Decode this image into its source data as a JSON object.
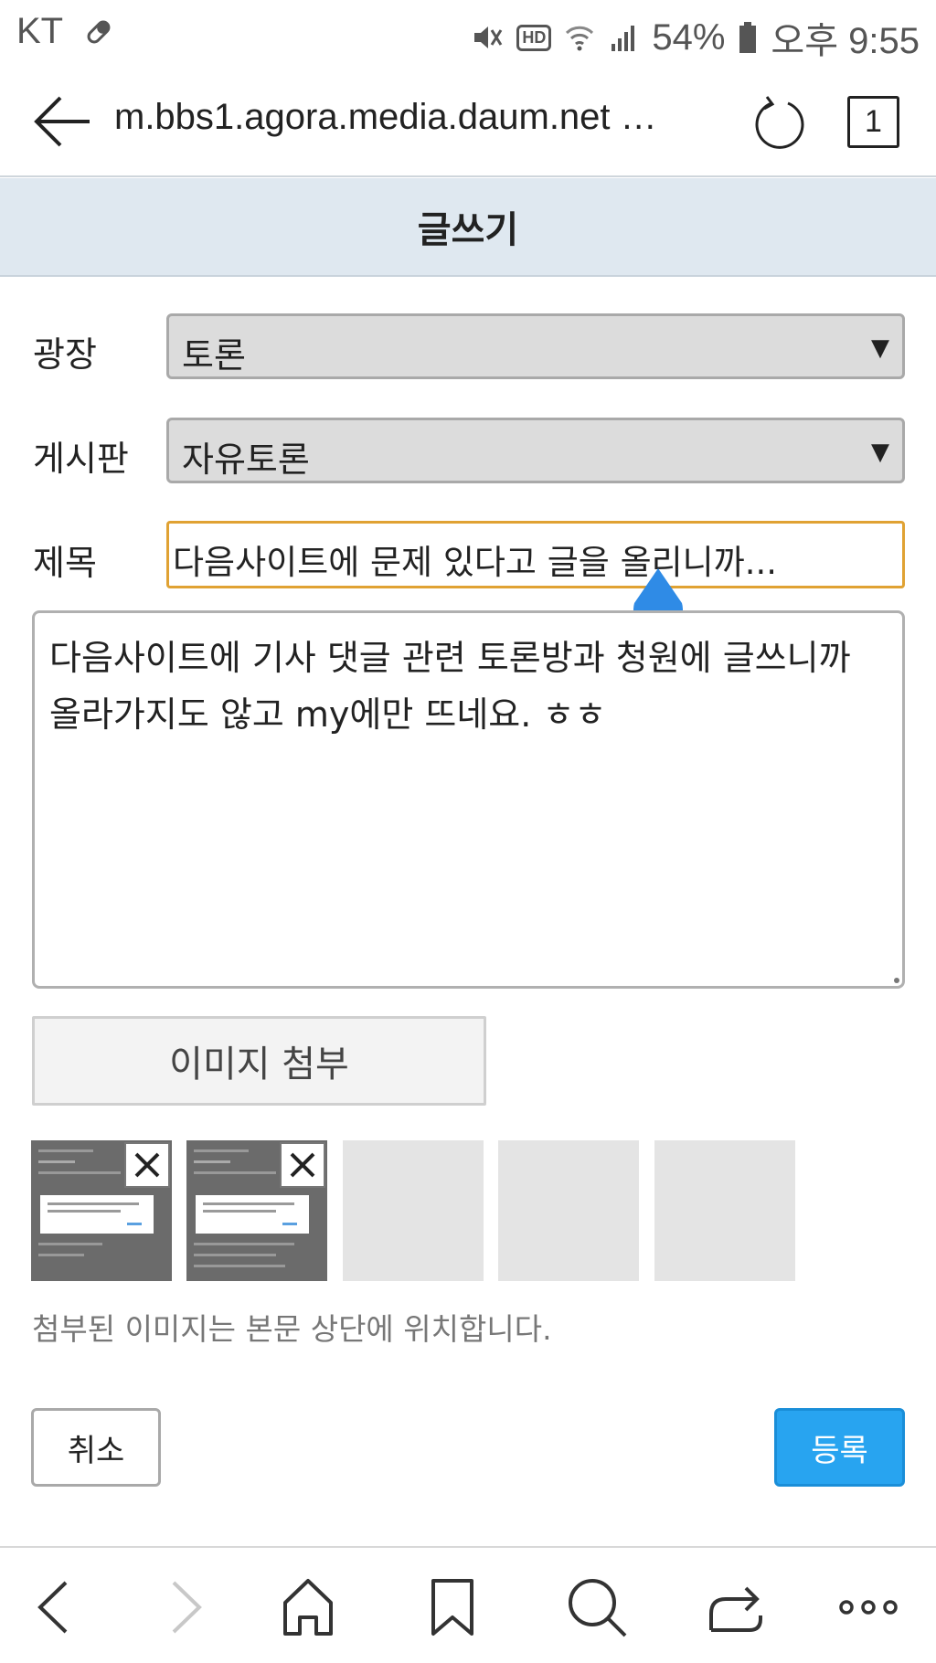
{
  "status_bar": {
    "carrier": "KT",
    "battery": "54%",
    "time": "오후 9:55",
    "hd_label": "HD"
  },
  "browser": {
    "url": "m.bbs1.agora.media.daum.net …",
    "tab_count": "1"
  },
  "page": {
    "title": "글쓰기"
  },
  "form": {
    "plaza_label": "광장",
    "plaza_value": "토론",
    "board_label": "게시판",
    "board_value": "자유토론",
    "subject_label": "제목",
    "subject_value": "다음사이트에 문제 있다고 글을 올리니까...",
    "body_value": "다음사이트에 기사 댓글 관련 토론방과 청원에 글쓰니까 올라가지도 않고 my에만 뜨네요. ㅎㅎ",
    "select_arrow": "▼"
  },
  "attachments": {
    "button_label": "이미지 첨부",
    "note": "첨부된 이미지는 본문 상단에 위치합니다.",
    "slots": [
      {
        "state": "filled"
      },
      {
        "state": "filled"
      },
      {
        "state": "empty"
      },
      {
        "state": "empty"
      },
      {
        "state": "empty"
      }
    ]
  },
  "actions": {
    "cancel_label": "취소",
    "submit_label": "등록"
  },
  "colors": {
    "accent": "#28a4f0",
    "header_bg": "#dfe8f0",
    "focus_border": "#e0a233",
    "cursor_handle": "#2f8be6"
  }
}
